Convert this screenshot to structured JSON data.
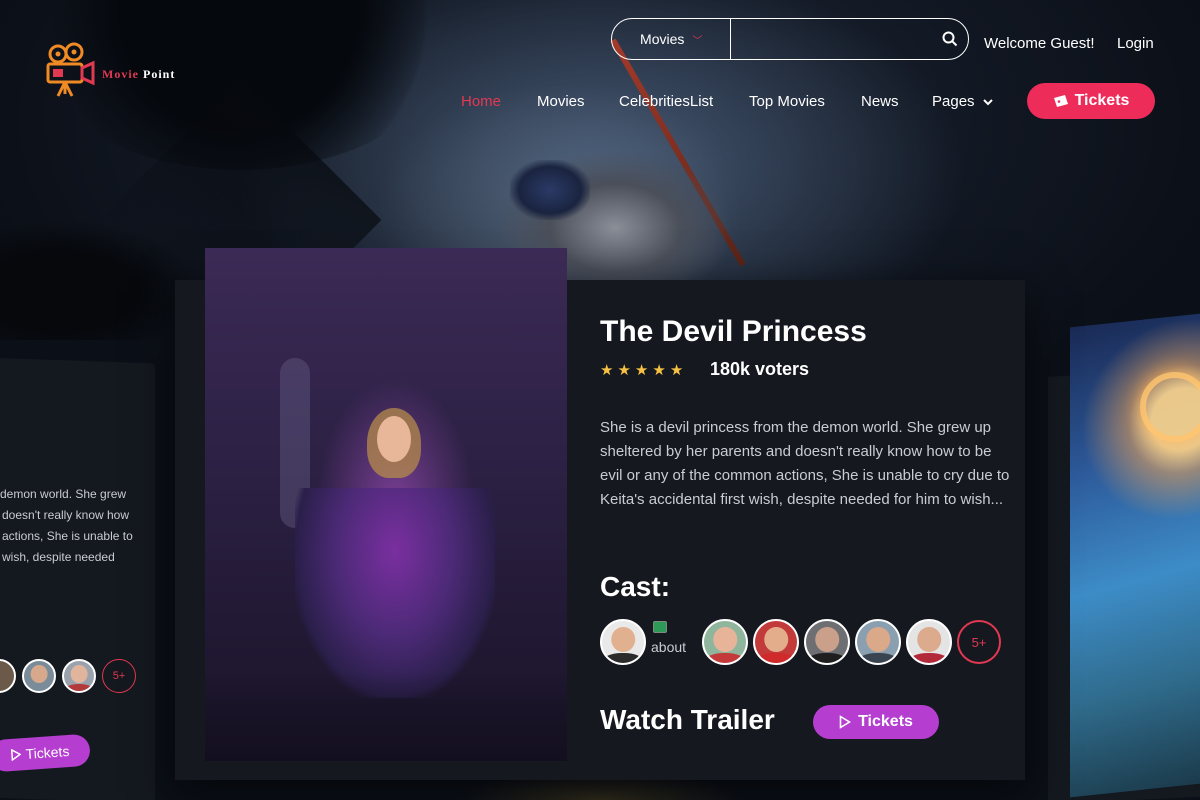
{
  "brand": {
    "word1": "Movie",
    "word2": "Point",
    "accent": "#e23852"
  },
  "search": {
    "category": "Movies",
    "placeholder": "",
    "value": ""
  },
  "header": {
    "welcome": "Welcome Guest!",
    "login": "Login"
  },
  "nav": {
    "items": [
      {
        "label": "Home",
        "active": true
      },
      {
        "label": "Movies"
      },
      {
        "label": "CelebritiesList"
      },
      {
        "label": "Top Movies"
      },
      {
        "label": "News"
      },
      {
        "label": "Pages"
      }
    ],
    "tickets_label": "Tickets"
  },
  "left_card": {
    "desc_lines": [
      "demon world. She grew",
      "doesn't really know how",
      "actions, She is unable to",
      "wish, despite needed"
    ],
    "more_label": "5+",
    "tickets_label": "Tickets"
  },
  "movie": {
    "title": "The Devil Princess",
    "rating_stars": 5,
    "voters": "180k voters",
    "description": "She is a devil princess from the demon world. She grew up sheltered by her parents and doesn't really know how to be evil or any of the common actions, She is unable to cry due to Keita's accidental first wish, despite needed for him to wish...",
    "cast_title": "Cast:",
    "broken_avatar_alt": "about",
    "more_cast": "5+",
    "watch_title": "Watch Trailer",
    "trailer_button": "Tickets"
  },
  "colors": {
    "accent": "#e23852",
    "tickets_bg": "#ee2c5a",
    "purple": "#b53ed0",
    "star": "#f7c244",
    "card": "#15181f"
  }
}
